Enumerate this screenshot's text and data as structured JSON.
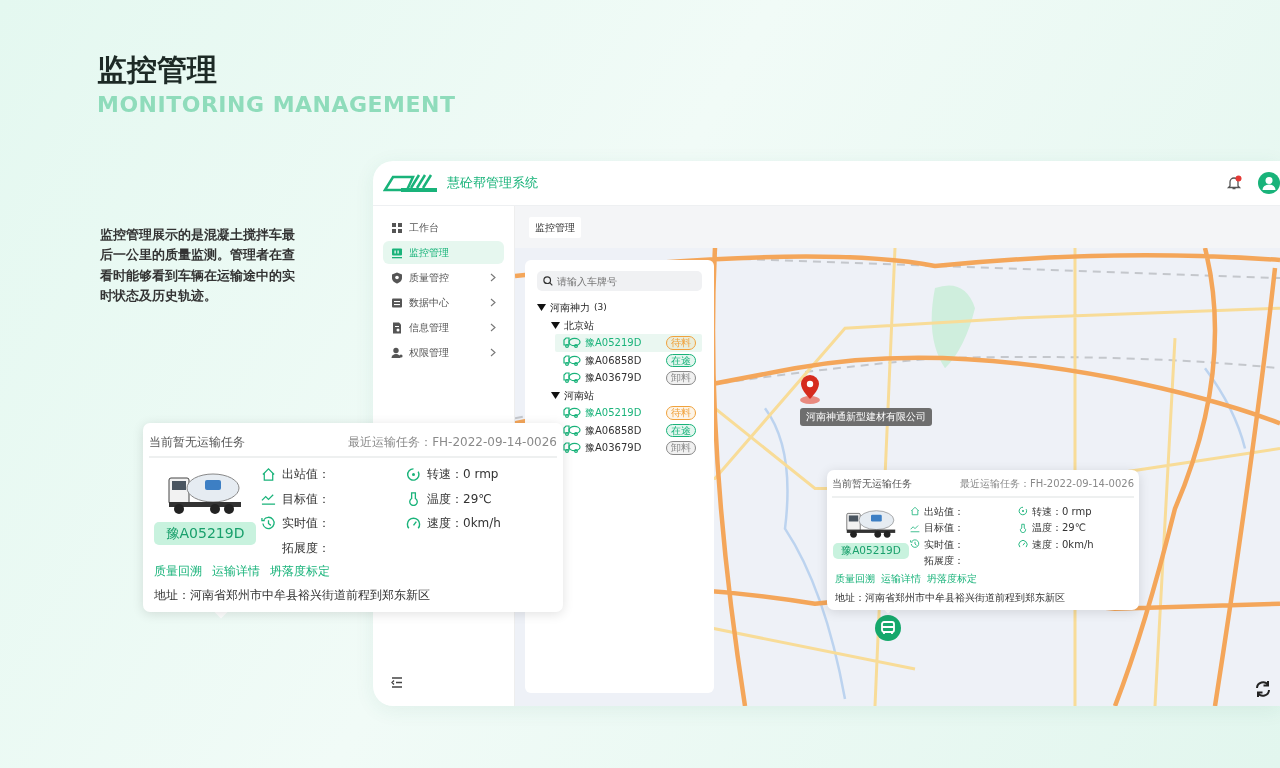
{
  "page": {
    "title": "监控管理",
    "subtitle": "MONITORING MANAGEMENT",
    "description": "监控管理展示的是混凝土搅拌车最后一公里的质量监测。管理者在查看时能够看到车辆在运输途中的实时状态及历史轨迹。"
  },
  "app": {
    "title": "慧砼帮管理系统",
    "notification_unread": true
  },
  "sidebar": {
    "items": [
      {
        "label": "工作台",
        "selected": false,
        "expandable": false
      },
      {
        "label": "监控管理",
        "selected": true,
        "expandable": false
      },
      {
        "label": "质量管控",
        "selected": false,
        "expandable": true
      },
      {
        "label": "数据中心",
        "selected": false,
        "expandable": true
      },
      {
        "label": "信息管理",
        "selected": false,
        "expandable": true
      },
      {
        "label": "权限管理",
        "selected": false,
        "expandable": true
      }
    ]
  },
  "breadcrumb": {
    "tab": "监控管理"
  },
  "vehicle_panel": {
    "search_placeholder": "请输入车牌号",
    "tree": [
      {
        "label": "河南神力",
        "count": "(3)",
        "expanded": true,
        "children": [
          {
            "label": "北京站",
            "expanded": true,
            "children": [
              {
                "plate": "豫A05219D",
                "status": "待料",
                "color": "#f0a23c",
                "active": true,
                "selected": true
              },
              {
                "plate": "豫A06858D",
                "status": "在途",
                "color": "#19b37a",
                "active": false,
                "selected": false
              },
              {
                "plate": "豫A03679D",
                "status": "卸料",
                "color": "#888888",
                "active": false,
                "selected": false
              }
            ]
          },
          {
            "label": "河南站",
            "expanded": true,
            "children": [
              {
                "plate": "豫A05219D",
                "status": "待料",
                "color": "#f0a23c",
                "active": true,
                "selected": false
              },
              {
                "plate": "豫A06858D",
                "status": "在途",
                "color": "#19b37a",
                "active": false,
                "selected": false
              },
              {
                "plate": "豫A03679D",
                "status": "卸料",
                "color": "#888888",
                "active": false,
                "selected": false
              }
            ]
          }
        ]
      }
    ]
  },
  "map": {
    "marker_label": "河南神通新型建材有限公司"
  },
  "popups": [
    {
      "status": "当前暂无运输任务",
      "recent": "最近运输任务：FH-2022-09-14-0026",
      "plate": "豫A05219D",
      "left_metrics": [
        {
          "text": "出站值："
        },
        {
          "text": "目标值："
        },
        {
          "text": "实时值："
        },
        {
          "text": "拓展度："
        }
      ],
      "right_metrics": [
        {
          "text": "转速：0 rmp"
        },
        {
          "text": "温度：29℃"
        },
        {
          "text": "速度：0km/h"
        }
      ],
      "links": [
        "质量回溯",
        "运输详情",
        "坍落度标定"
      ],
      "address": "地址：河南省郑州市中牟县裕兴街道前程到郑东新区"
    },
    {
      "status": "当前暂无运输任务",
      "recent": "最近运输任务：FH-2022-09-14-0026",
      "plate": "豫A05219D",
      "left_metrics": [
        {
          "text": "出站值："
        },
        {
          "text": "目标值："
        },
        {
          "text": "实时值："
        },
        {
          "text": "拓展度："
        }
      ],
      "right_metrics": [
        {
          "text": "转速：0 rmp"
        },
        {
          "text": "温度：29℃"
        },
        {
          "text": "速度：0km/h"
        }
      ],
      "links": [
        "质量回溯",
        "运输详情",
        "坍落度标定"
      ],
      "address": "地址：河南省郑州市中牟县裕兴街道前程到郑东新区"
    }
  ]
}
